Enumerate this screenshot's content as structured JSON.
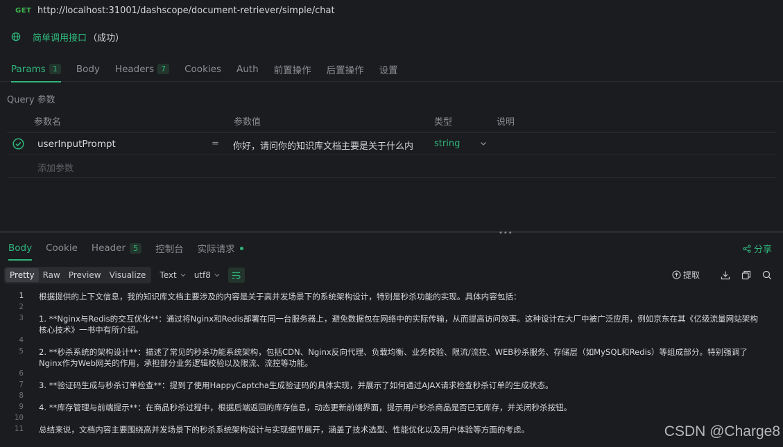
{
  "url_bar": {
    "method": "GET",
    "url": "http://localhost:31001/dashscope/document-retriever/simple/chat"
  },
  "api": {
    "name": "简单调用接口",
    "status": "（成功）"
  },
  "request_tabs": [
    {
      "label": "Params",
      "badge": "1"
    },
    {
      "label": "Body"
    },
    {
      "label": "Headers",
      "badge": "7"
    },
    {
      "label": "Cookies"
    },
    {
      "label": "Auth"
    },
    {
      "label": "前置操作"
    },
    {
      "label": "后置操作"
    },
    {
      "label": "设置"
    }
  ],
  "params": {
    "section_label": "Query 参数",
    "headers": {
      "name": "参数名",
      "value": "参数值",
      "type": "类型",
      "desc": "说明"
    },
    "row": {
      "key": "userInputPrompt",
      "eq": "=",
      "value": "你好，请问你的知识库文档主要是关于什么内",
      "type": "string"
    },
    "add_label": "添加参数"
  },
  "response_tabs": [
    {
      "label": "Body"
    },
    {
      "label": "Cookie"
    },
    {
      "label": "Header",
      "badge": "5"
    },
    {
      "label": "控制台"
    },
    {
      "label": "实际请求"
    }
  ],
  "share_label": "分享",
  "toolbar": {
    "modes": [
      "Pretty",
      "Raw",
      "Preview",
      "Visualize"
    ],
    "format": "Text",
    "encoding": "utf8",
    "extract_label": "提取"
  },
  "code_lines": [
    {
      "n": "1",
      "text": "根据提供的上下文信息，我的知识库文档主要涉及的内容是关于高并发场景下的系统架构设计，特别是秒杀功能的实现。具体内容包括："
    },
    {
      "n": "2",
      "text": ""
    },
    {
      "n": "3",
      "text": "1. **Nginx与Redis的交互优化**：通过将Nginx和Redis部署在同一台服务器上，避免数据包在网络中的实际传输，从而提高访问效率。这种设计在大厂中被广泛应用，例如京东在其《亿级流量网站架构核心技术》一书中有所介绍。"
    },
    {
      "n": "4",
      "text": ""
    },
    {
      "n": "5",
      "text": "2. **秒杀系统的架构设计**：描述了常见的秒杀功能系统架构，包括CDN、Nginx反向代理、负载均衡、业务校验、限流/流控、WEB秒杀服务、存储层（如MySQL和Redis）等组成部分。特别强调了Nginx作为Web网关的作用，承担部分业务逻辑校验以及限流、流控等功能。"
    },
    {
      "n": "6",
      "text": ""
    },
    {
      "n": "7",
      "text": "3. **验证码生成与秒杀订单检查**：提到了使用HappyCaptcha生成验证码的具体实现，并展示了如何通过AJAX请求检查秒杀订单的生成状态。"
    },
    {
      "n": "8",
      "text": ""
    },
    {
      "n": "9",
      "text": "4. **库存管理与前端提示**：在商品秒杀过程中，根据后端返回的库存信息，动态更新前端界面，提示用户秒杀商品是否已无库存，并关闭秒杀按钮。"
    },
    {
      "n": "10",
      "text": ""
    },
    {
      "n": "11",
      "text": "总结来说，文档内容主要围绕高并发场景下的秒杀系统架构设计与实现细节展开，涵盖了技术选型、性能优化以及用户体验等方面的考虑。"
    }
  ],
  "watermark": "CSDN @Charge8"
}
